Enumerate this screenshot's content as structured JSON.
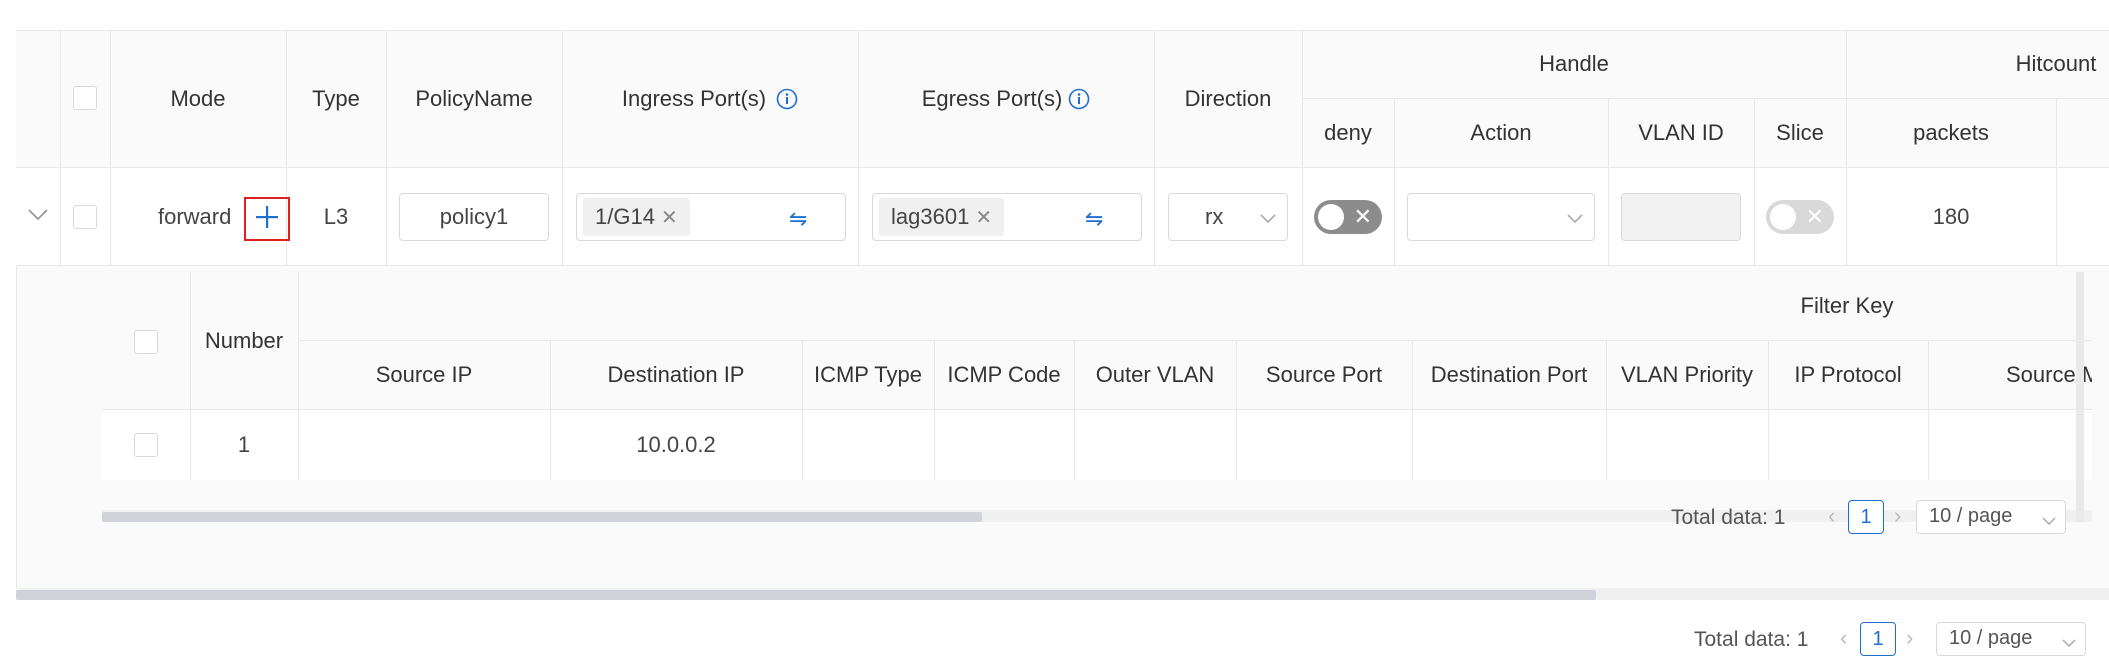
{
  "main_table": {
    "headers": {
      "mode": "Mode",
      "type": "Type",
      "policy_name": "PolicyName",
      "ingress_ports": "Ingress Port(s)",
      "egress_ports": "Egress Port(s)",
      "direction": "Direction",
      "handle": "Handle",
      "deny": "deny",
      "action": "Action",
      "vlan_id": "VLAN ID",
      "slice": "Slice",
      "hitcount": "Hitcount",
      "packets": "packets"
    },
    "row": {
      "mode": "forward",
      "type": "L3",
      "policy_name": "policy1",
      "ingress_tag": "1/G14",
      "egress_tag": "lag3601",
      "direction": "rx",
      "action": "",
      "vlan_id": "",
      "packets": "180"
    }
  },
  "sub_table": {
    "headers": {
      "number": "Number",
      "filter_key": "Filter Key",
      "source_ip": "Source IP",
      "destination_ip": "Destination IP",
      "icmp_type": "ICMP Type",
      "icmp_code": "ICMP Code",
      "outer_vlan": "Outer VLAN",
      "source_port": "Source Port",
      "destination_port": "Destination Port",
      "vlan_priority": "VLAN Priority",
      "ip_protocol": "IP Protocol",
      "source_mac": "Source M..."
    },
    "rows": [
      {
        "number": "1",
        "source_ip": "",
        "destination_ip": "10.0.0.2"
      }
    ],
    "pagination": {
      "total_label": "Total data: 1",
      "current_page": "1",
      "page_size": "10 / page"
    }
  },
  "outer_pagination": {
    "total_label": "Total data: 1",
    "current_page": "1",
    "page_size": "10 / page"
  },
  "colors": {
    "accent": "#1f6fd1",
    "highlight_border": "#e02020",
    "header_bg": "#fafafa",
    "switch_off": "#bfbfbf"
  },
  "icons": [
    "chevron-down-icon",
    "plus-icon",
    "info-icon",
    "swap-icon",
    "close-icon"
  ]
}
